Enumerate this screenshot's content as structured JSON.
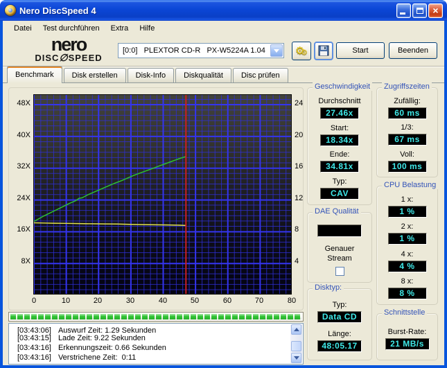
{
  "window": {
    "title": "Nero DiscSpeed 4"
  },
  "icons": {
    "app_icon": "nero-disc-badge",
    "options_button": "gear-glyphs",
    "save_button": "floppy-disk",
    "combo_button": "chevron-down-triangle",
    "scroll_up": "triangle-up",
    "scroll_down": "triangle-down",
    "close": "×"
  },
  "menu": {
    "items": [
      "Datei",
      "Test durchführen",
      "Extra",
      "Hilfe"
    ]
  },
  "toolbar": {
    "logo_top": "nero",
    "logo_bottom_left": "DISC",
    "logo_disc_glyph": "∅",
    "logo_bottom_right": "SPEED",
    "drive_selector": "[0:0]   PLEXTOR CD-R   PX-W5224A 1.04",
    "start_button": "Start",
    "quit_button": "Beenden"
  },
  "tabs": {
    "active_index": 0,
    "items": [
      "Benchmark",
      "Disk erstellen",
      "Disk-Info",
      "Diskqualität",
      "Disc prüfen"
    ]
  },
  "chart_data": {
    "type": "line",
    "x_axis": {
      "min": 0,
      "max": 80,
      "tick_labels": [
        "0",
        "10",
        "20",
        "30",
        "40",
        "50",
        "60",
        "70",
        "80"
      ]
    },
    "y_axis_left": {
      "unit": "x speed",
      "max_value": 50.4,
      "tick_labels": [
        "48X",
        "40X",
        "32X",
        "24X",
        "16X",
        "8X"
      ]
    },
    "y_axis_right": {
      "tick_labels": [
        "24",
        "20",
        "16",
        "12",
        "8",
        "4"
      ]
    },
    "grid": "blue minor/major grid on dark gradient background",
    "series": [
      {
        "name": "read-speed",
        "color": "#2EC22E",
        "points": [
          [
            0,
            18.34
          ],
          [
            1,
            18.8
          ],
          [
            3,
            19.7
          ],
          [
            5,
            20.5
          ],
          [
            7,
            21.3
          ],
          [
            9,
            22.1
          ],
          [
            11,
            22.9
          ],
          [
            13,
            23.6
          ],
          [
            14,
            24.2
          ],
          [
            15,
            24.35
          ],
          [
            17,
            25.2
          ],
          [
            19,
            25.9
          ],
          [
            21,
            26.6
          ],
          [
            23,
            27.3
          ],
          [
            25,
            28.0
          ],
          [
            27,
            28.6
          ],
          [
            29,
            29.3
          ],
          [
            31,
            30.0
          ],
          [
            33,
            30.6
          ],
          [
            35,
            31.2
          ],
          [
            37,
            31.8
          ],
          [
            39,
            32.4
          ],
          [
            41,
            33.0
          ],
          [
            43,
            33.6
          ],
          [
            45,
            34.2
          ],
          [
            47.3,
            34.81
          ]
        ]
      },
      {
        "name": "rotation-speed",
        "color": "#E3E34A",
        "points": [
          [
            0,
            18.0
          ],
          [
            3,
            17.95
          ],
          [
            6,
            17.9
          ],
          [
            10,
            17.85
          ],
          [
            14,
            17.8
          ],
          [
            18,
            17.76
          ],
          [
            22,
            17.72
          ],
          [
            26,
            17.68
          ],
          [
            30,
            17.62
          ],
          [
            34,
            17.55
          ],
          [
            38,
            17.5
          ],
          [
            42,
            17.45
          ],
          [
            45,
            17.4
          ],
          [
            47.3,
            17.32
          ]
        ]
      }
    ],
    "end_marker": {
      "x": 47.3,
      "color": "#CC2020"
    }
  },
  "panels": {
    "speed": {
      "title": "Geschwindigkeit",
      "fields": [
        {
          "label": "Durchschnitt",
          "value": "27.46x"
        },
        {
          "label": "Start:",
          "value": "18.34x"
        },
        {
          "label": "Ende:",
          "value": "34.81x"
        },
        {
          "label": "Typ:",
          "value": "CAV"
        }
      ]
    },
    "access": {
      "title": "Zugriffszeiten",
      "fields": [
        {
          "label": "Zufällig:",
          "value": "60 ms"
        },
        {
          "label": "1/3:",
          "value": "67 ms"
        },
        {
          "label": "Voll:",
          "value": "100 ms"
        }
      ]
    },
    "cpu": {
      "title": "CPU Belastung",
      "fields": [
        {
          "label": "1 x:",
          "value": "1 %"
        },
        {
          "label": "2 x:",
          "value": "1 %"
        },
        {
          "label": "4 x:",
          "value": "4 %"
        },
        {
          "label": "8 x:",
          "value": "8 %"
        }
      ]
    },
    "dae": {
      "title": "DAE Qualität",
      "value": "",
      "check_label_1": "Genauer",
      "check_label_2": "Stream",
      "checked": false
    },
    "disc": {
      "title": "Disktyp:",
      "fields": [
        {
          "label": "Typ:",
          "value": "Data CD"
        },
        {
          "label": "Länge:",
          "value": "48:05.17"
        }
      ]
    },
    "iface": {
      "title": "Schnittstelle",
      "fields": [
        {
          "label": "Burst-Rate:",
          "value": "21 MB/s"
        }
      ]
    }
  },
  "progress": {
    "filled": true
  },
  "log": {
    "lines": [
      {
        "time": "[03:43:06]",
        "text": "Auswurf Zeit: 1.29 Sekunden"
      },
      {
        "time": "[03:43:15]",
        "text": "Lade Zeit: 9.22 Sekunden"
      },
      {
        "time": "[03:43:16]",
        "text": "Erkennungszeit: 0.66 Sekunden"
      },
      {
        "time": "[03:43:16]",
        "text": "Verstrichene Zeit:  0:11"
      }
    ]
  }
}
